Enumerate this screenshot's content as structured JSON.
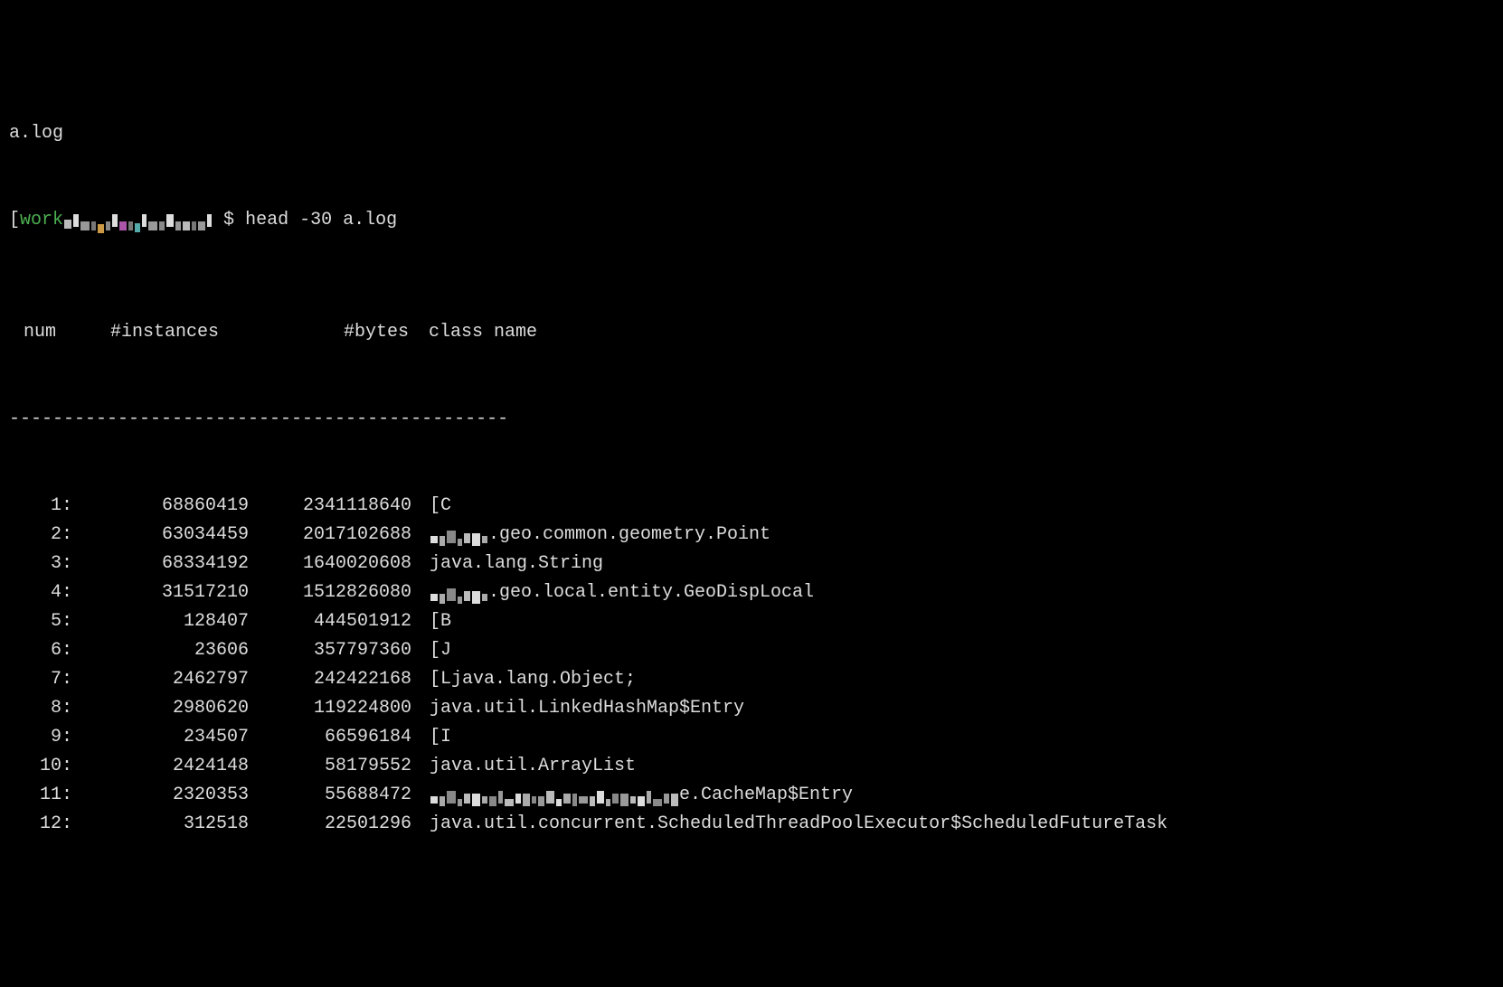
{
  "top_line": "a.log",
  "prompt": {
    "bracket_open": "[",
    "label": "work",
    "bracket_close_prefix": "",
    "dollar": "$",
    "command": "head -30 a.log"
  },
  "headers": {
    "num": "num",
    "instances": "#instances",
    "bytes": "#bytes",
    "classname": "class name"
  },
  "divider": "----------------------------------------------",
  "rows": [
    {
      "num": "1:",
      "instances": "68860419",
      "bytes": "2341118640",
      "class_prefix": "",
      "class_suffix": "[C",
      "redacted": false
    },
    {
      "num": "2:",
      "instances": "63034459",
      "bytes": "2017102688",
      "class_prefix": "",
      "class_suffix": ".geo.common.geometry.Point",
      "redacted": true
    },
    {
      "num": "3:",
      "instances": "68334192",
      "bytes": "1640020608",
      "class_prefix": "",
      "class_suffix": "java.lang.String",
      "redacted": false
    },
    {
      "num": "4:",
      "instances": "31517210",
      "bytes": "1512826080",
      "class_prefix": "",
      "class_suffix": ".geo.local.entity.GeoDispLocal",
      "redacted": true
    },
    {
      "num": "5:",
      "instances": "128407",
      "bytes": "444501912",
      "class_prefix": "",
      "class_suffix": "[B",
      "redacted": false
    },
    {
      "num": "6:",
      "instances": "23606",
      "bytes": "357797360",
      "class_prefix": "",
      "class_suffix": "[J",
      "redacted": false
    },
    {
      "num": "7:",
      "instances": "2462797",
      "bytes": "242422168",
      "class_prefix": "",
      "class_suffix": "[Ljava.lang.Object;",
      "redacted": false
    },
    {
      "num": "8:",
      "instances": "2980620",
      "bytes": "119224800",
      "class_prefix": "",
      "class_suffix": "java.util.LinkedHashMap$Entry",
      "redacted": false
    },
    {
      "num": "9:",
      "instances": "234507",
      "bytes": "66596184",
      "class_prefix": "",
      "class_suffix": "[I",
      "redacted": false
    },
    {
      "num": "10:",
      "instances": "2424148",
      "bytes": "58179552",
      "class_prefix": "",
      "class_suffix": "java.util.ArrayList",
      "redacted": false
    },
    {
      "num": "11:",
      "instances": "2320353",
      "bytes": "55688472",
      "class_prefix": "",
      "class_suffix": "e.CacheMap$Entry",
      "redacted": true,
      "redact_wide": true
    },
    {
      "num": "12:",
      "instances": "312518",
      "bytes": "22501296",
      "class_prefix": "",
      "class_suffix": "java.util.concurrent.ScheduledThreadPoolExecutor$ScheduledFutureTask",
      "redacted": false
    }
  ]
}
